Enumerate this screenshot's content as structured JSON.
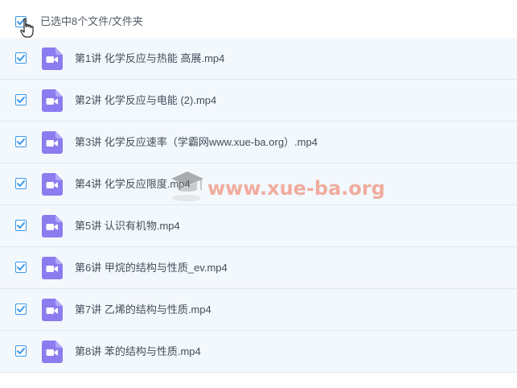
{
  "header": {
    "selection_label": "已选中8个文件/文件夹",
    "select_all_checked": true
  },
  "files": [
    {
      "name": "第1讲 化学反应与热能 高展.mp4",
      "checked": true,
      "icon": "video-file-icon"
    },
    {
      "name": "第2讲 化学反应与电能 (2).mp4",
      "checked": true,
      "icon": "video-file-icon"
    },
    {
      "name": "第3讲 化学反应速率（学霸网www.xue-ba.org）.mp4",
      "checked": true,
      "icon": "video-file-icon"
    },
    {
      "name": "第4讲 化学反应限度.mp4",
      "checked": true,
      "icon": "video-file-icon"
    },
    {
      "name": "第5讲 认识有机物.mp4",
      "checked": true,
      "icon": "video-file-icon"
    },
    {
      "name": "第6讲 甲烷的结构与性质_ev.mp4",
      "checked": true,
      "icon": "video-file-icon"
    },
    {
      "name": "第7讲 乙烯的结构与性质.mp4",
      "checked": true,
      "icon": "video-file-icon"
    },
    {
      "name": "第8讲 苯的结构与性质.mp4",
      "checked": true,
      "icon": "video-file-icon"
    }
  ],
  "watermark": {
    "text": "www.xue-ba.org",
    "icon": "graduation-cap-icon"
  },
  "colors": {
    "accent": "#3a97e8",
    "video_icon": "#8c7cf0",
    "row_background": "#f3f8fd",
    "watermark": "#ed6e50"
  }
}
